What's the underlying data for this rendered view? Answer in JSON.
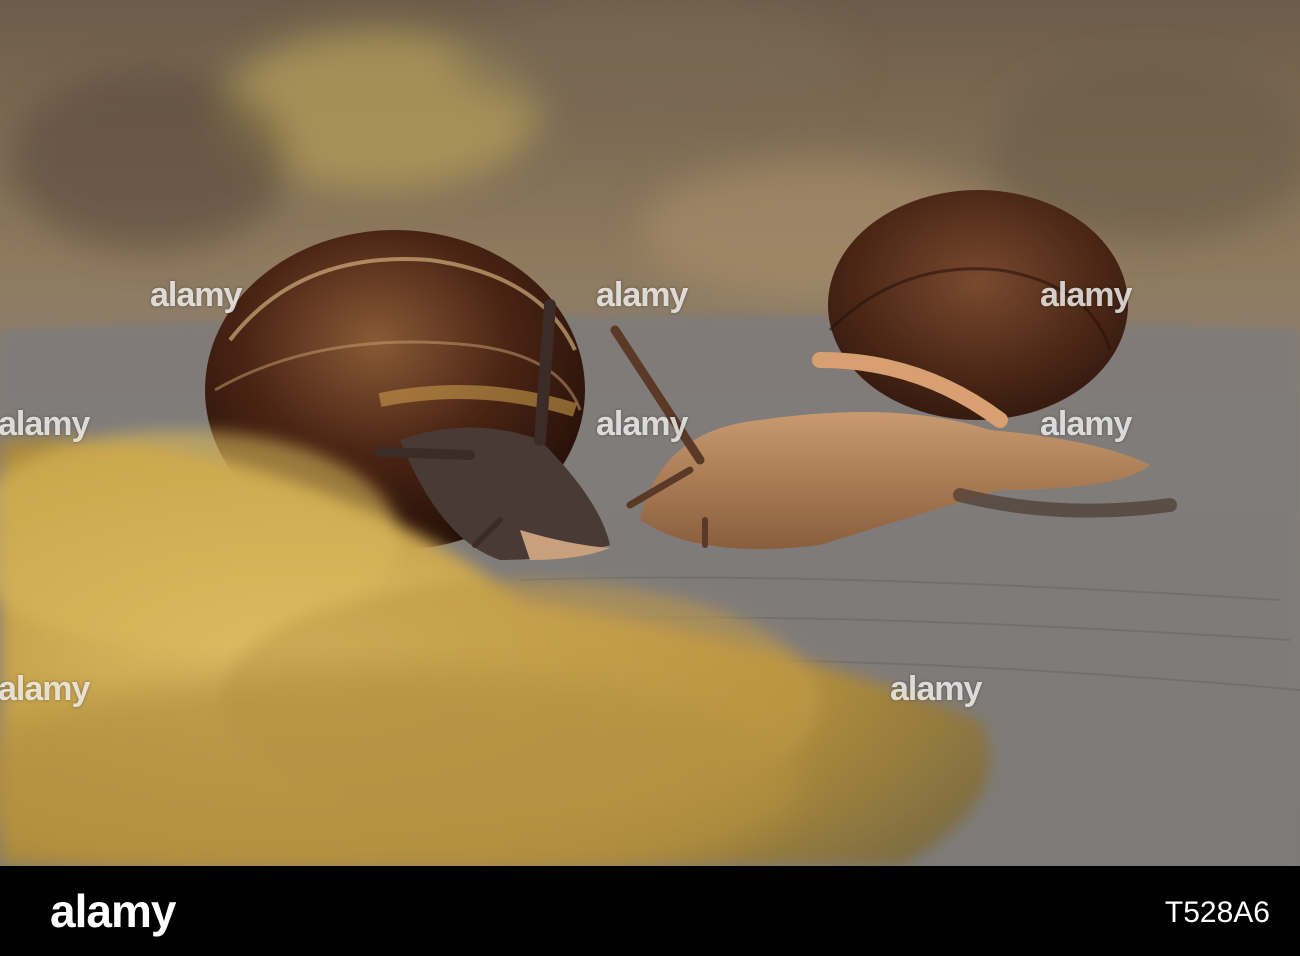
{
  "photo": {
    "subject": "two garden snails on a weathered wooden surface with moss",
    "colors": {
      "background": "#8a7a66",
      "wood": "#7d7a78",
      "moss": "#c9a24a",
      "shell": "#4a2a18",
      "body": "#b88a60"
    }
  },
  "watermark": {
    "text": "alamy"
  },
  "footer": {
    "logo": "alamy",
    "image_id": "T528A6"
  }
}
